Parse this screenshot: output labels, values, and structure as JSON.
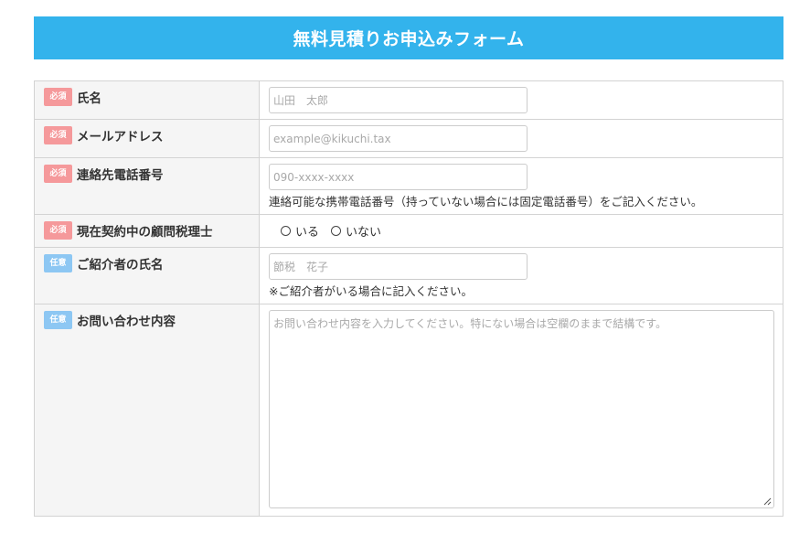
{
  "form": {
    "title": "無料見積りお申込みフォーム",
    "badges": {
      "required": "必須",
      "optional": "任意"
    },
    "fields": {
      "name": {
        "label": "氏名",
        "placeholder": "山田　太郎"
      },
      "email": {
        "label": "メールアドレス",
        "placeholder": "example@kikuchi.tax"
      },
      "phone": {
        "label": "連絡先電話番号",
        "placeholder": "090-xxxx-xxxx",
        "note": "連絡可能な携帯電話番号（持っていない場合には固定電話番号）をご記入ください。"
      },
      "tax_accountant": {
        "label": "現在契約中の顧問税理士",
        "options": [
          "いる",
          "いない"
        ]
      },
      "referrer": {
        "label": "ご紹介者の氏名",
        "placeholder": "節税　花子",
        "note": "※ご紹介者がいる場合に記入ください。"
      },
      "inquiry": {
        "label": "お問い合わせ内容",
        "placeholder": "お問い合わせ内容を入力してください。特にない場合は空欄のままで結構です。"
      }
    }
  }
}
